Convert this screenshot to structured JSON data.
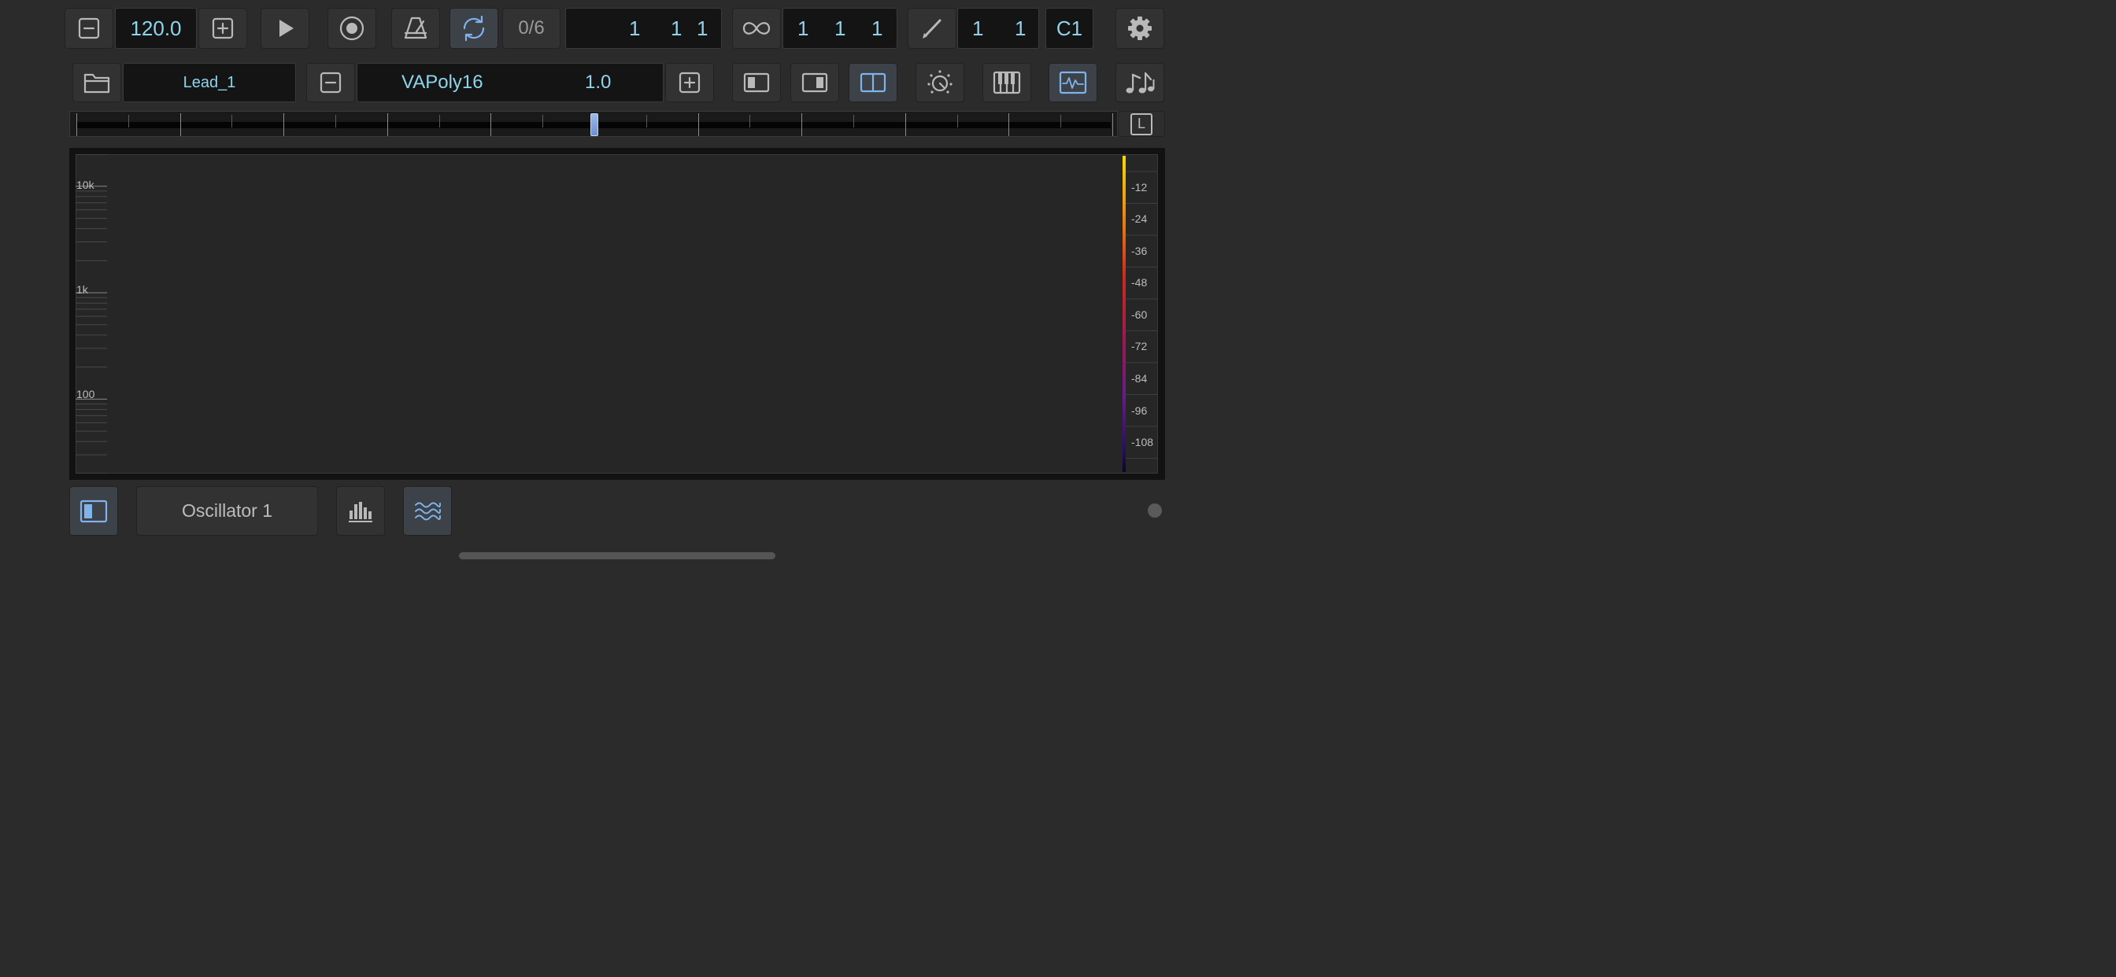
{
  "transport": {
    "tempo": "120.0",
    "count_in": "0/6",
    "position": {
      "bar": "1",
      "beat": "1",
      "tick": "1"
    },
    "loop_length": {
      "bar": "1",
      "beat": "1",
      "tick": "1"
    },
    "edit_grid": {
      "a": "1",
      "b": "1"
    },
    "key": "C1",
    "icons": [
      "minus-icon",
      "plus-icon",
      "play-icon",
      "record-icon",
      "metronome-icon",
      "loop-icon",
      "infinity-icon",
      "pencil-icon",
      "gear-icon"
    ]
  },
  "track": {
    "preset_name": "Lead_1",
    "instrument_name": "VAPoly16",
    "instrument_version": "1.0",
    "icons": [
      "folder-icon",
      "minus-icon",
      "plus-icon",
      "panel-left-icon",
      "panel-right-icon",
      "panel-split-icon",
      "knob-icon",
      "keyboard-icon",
      "waveform-icon",
      "notes-icon"
    ]
  },
  "timeline": {
    "lock_label": "L",
    "playhead_position": 0.5
  },
  "spectrogram": {
    "freq_labels": [
      "10k",
      "1k",
      "100"
    ],
    "db_labels": [
      "-12",
      "-24",
      "-36",
      "-48",
      "-60",
      "-72",
      "-84",
      "-96",
      "-108"
    ],
    "colors": {
      "hot": "#f5d90a",
      "mid": "#c0201e",
      "cold": "#1a0a6e",
      "bg": "#262626"
    }
  },
  "bottom": {
    "source_label": "Oscillator 1",
    "icons": [
      "panel-toggle-icon",
      "bars-icon",
      "waves-icon",
      "status-dot-icon"
    ]
  }
}
